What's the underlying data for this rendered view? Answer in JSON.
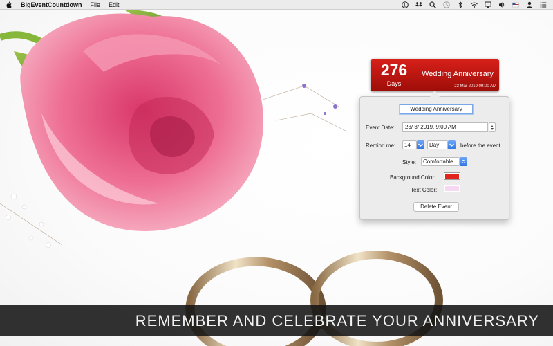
{
  "menubar": {
    "app_name": "BigEventCountdown",
    "menus": [
      "File",
      "Edit"
    ],
    "status_icons": [
      "lastpass-icon",
      "dropbox-icon",
      "spotlight-icon",
      "time-machine-icon",
      "bluetooth-icon",
      "wifi-icon",
      "airplay-icon",
      "volume-icon",
      "flag-icon",
      "user-icon",
      "notification-center-icon"
    ]
  },
  "badge": {
    "count": "276",
    "unit": "Days",
    "title": "Wedding Anniversary",
    "datetime": "23 Mar 2019 09:00 AM",
    "gradient": [
      "#d8201a",
      "#9d0d08"
    ]
  },
  "popover": {
    "title_value": "Wedding Anniversary",
    "event_date_label": "Event Date:",
    "event_date_value": "23/ 3/ 2019,  9:00 AM",
    "remind_label": "Remind me:",
    "remind_amount": "14",
    "remind_unit": "Day",
    "remind_suffix": "before the event",
    "style_label": "Style:",
    "style_value": "Comfortable",
    "bg_color_label": "Background Color:",
    "bg_color": "#e2231d",
    "text_color_label": "Text Color:",
    "text_color": "#f6d8f2",
    "delete_label": "Delete Event"
  },
  "banner": {
    "caption": "REMEMBER AND CELEBRATE YOUR ANNIVERSARY"
  },
  "colors": {
    "accent": "#2f75e3",
    "badge_red": "#c8150f"
  }
}
